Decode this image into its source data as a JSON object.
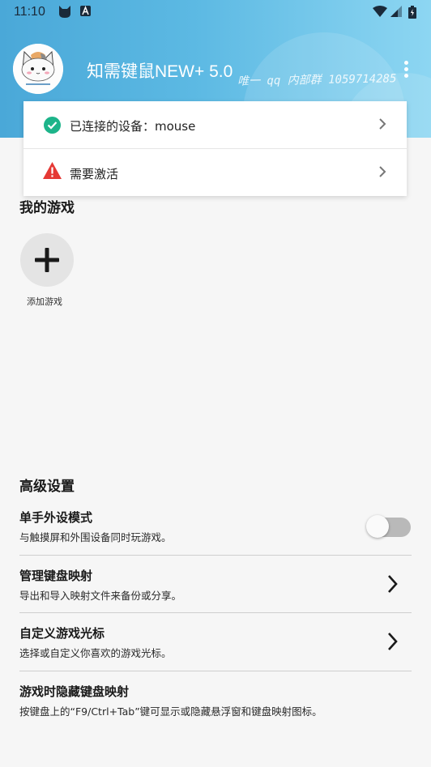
{
  "status_bar": {
    "time": "11:10",
    "icons": [
      "cat-notification-icon",
      "a-notification-icon",
      "wifi-icon",
      "signal-icon",
      "battery-icon"
    ]
  },
  "header": {
    "title": "知需键鼠NEW+ 5.0",
    "watermark": "唯一 qq 内部群 1059714285",
    "menu_icon": "more-vert-icon",
    "gradient_start": "#4aa8d8",
    "gradient_end": "#8dd6f2"
  },
  "status_card": {
    "connected": {
      "label": "已连接的设备：mouse",
      "icon": "check-circle-icon",
      "color": "#1db48a"
    },
    "activation": {
      "label": "需要激活",
      "icon": "warning-icon",
      "color": "#e53935"
    }
  },
  "games": {
    "title": "我的游戏",
    "add_label": "添加游戏"
  },
  "advanced": {
    "title": "高级设置",
    "items": [
      {
        "title": "单手外设模式",
        "desc": "与触摸屏和外围设备同时玩游戏。",
        "control": "toggle",
        "enabled": false
      },
      {
        "title": "管理键盘映射",
        "desc": "导出和导入映射文件来备份或分享。",
        "control": "chevron"
      },
      {
        "title": "自定义游戏光标",
        "desc": "选择或自定义你喜欢的游戏光标。",
        "control": "chevron"
      },
      {
        "title": "游戏时隐藏键盘映射",
        "desc": "按键盘上的“F9/Ctrl+Tab”键可显示或隐藏悬浮窗和键盘映射图标。",
        "control": "none"
      }
    ]
  }
}
